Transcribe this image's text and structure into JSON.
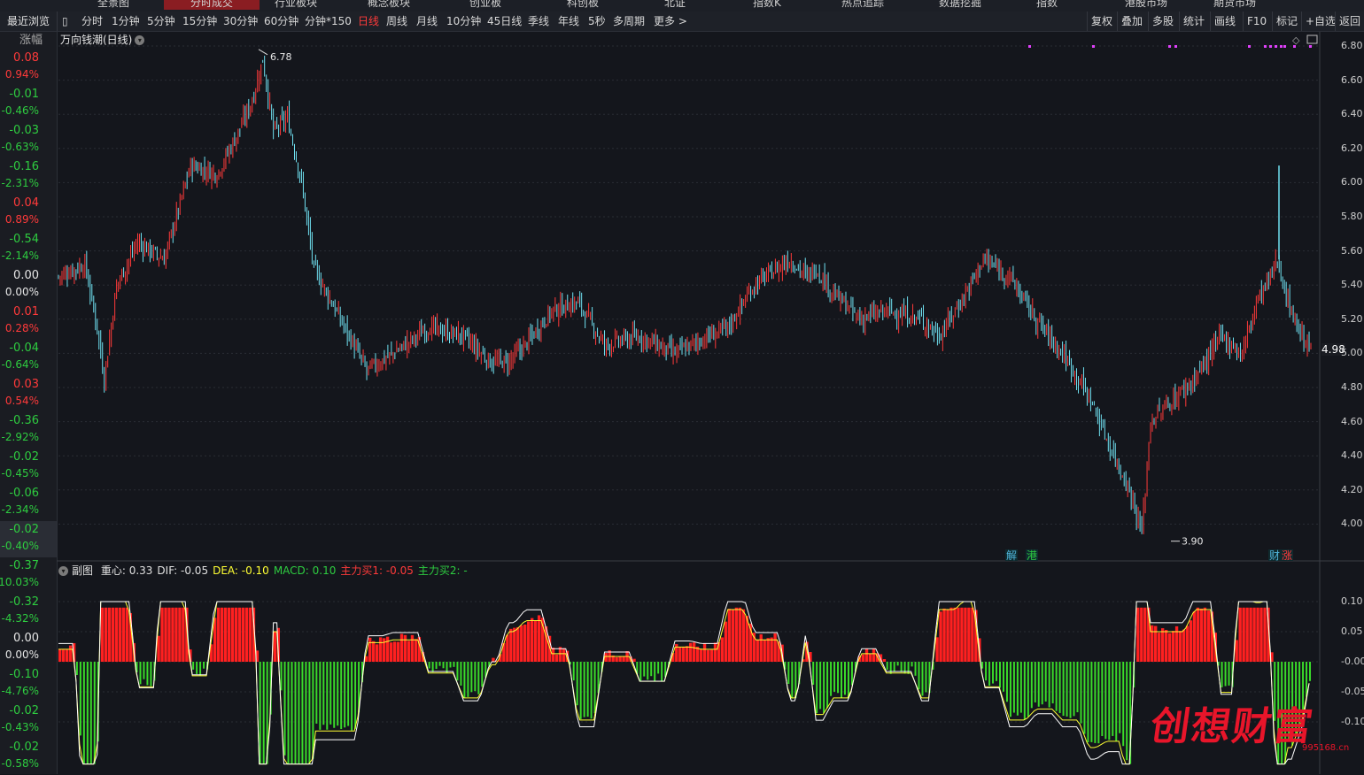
{
  "topnav": [
    "全景图",
    "分时成交",
    "行业板块",
    "概念板块",
    "创业板",
    "科创板",
    "北证",
    "指数K",
    "热点追踪",
    "数据挖掘",
    "指数",
    "港股市场",
    "期货市场"
  ],
  "toolbar": {
    "recent": "最近浏览",
    "periods": [
      "分时",
      "1分钟",
      "5分钟",
      "15分钟",
      "30分钟",
      "60分钟",
      "分钟*150",
      "日线",
      "周线",
      "月线",
      "10分钟",
      "45日线",
      "季线",
      "年线",
      "5秒",
      "多周期",
      "更多 >"
    ],
    "active_period": "日线",
    "right_tools": [
      "复权",
      "叠加",
      "多股",
      "统计",
      "画线",
      "F10",
      "标记",
      "+自选",
      "返回"
    ]
  },
  "left_panel": {
    "header": "涨幅",
    "items": [
      {
        "price": "0.08",
        "pct": "0.94%",
        "dir": "up"
      },
      {
        "price": "-0.01",
        "pct": "-0.46%",
        "dir": "dn"
      },
      {
        "price": "-0.03",
        "pct": "-0.63%",
        "dir": "dn"
      },
      {
        "price": "-0.16",
        "pct": "-2.31%",
        "dir": "dn"
      },
      {
        "price": "0.04",
        "pct": "0.89%",
        "dir": "up"
      },
      {
        "price": "-0.54",
        "pct": "-2.14%",
        "dir": "dn"
      },
      {
        "price": "0.00",
        "pct": "0.00%",
        "dir": "flat"
      },
      {
        "price": "0.01",
        "pct": "0.28%",
        "dir": "up"
      },
      {
        "price": "-0.04",
        "pct": "-0.64%",
        "dir": "dn"
      },
      {
        "price": "0.03",
        "pct": "0.54%",
        "dir": "up"
      },
      {
        "price": "-0.36",
        "pct": "-2.92%",
        "dir": "dn"
      },
      {
        "price": "-0.02",
        "pct": "-0.45%",
        "dir": "dn"
      },
      {
        "price": "-0.06",
        "pct": "-2.34%",
        "dir": "dn"
      },
      {
        "price": "-0.02",
        "pct": "-0.40%",
        "dir": "dn",
        "highlight": true
      },
      {
        "price": "-0.37",
        "pct": "-10.03%",
        "dir": "dn"
      },
      {
        "price": "-0.32",
        "pct": "-4.32%",
        "dir": "dn"
      },
      {
        "price": "0.00",
        "pct": "0.00%",
        "dir": "flat"
      },
      {
        "price": "-0.10",
        "pct": "-4.76%",
        "dir": "dn"
      },
      {
        "price": "-0.02",
        "pct": "-0.43%",
        "dir": "dn"
      },
      {
        "price": "-0.02",
        "pct": "-0.58%",
        "dir": "dn"
      }
    ]
  },
  "chart": {
    "title": "万向钱潮(日线)",
    "high_label": "6.78",
    "low_label": "3.90",
    "last_price": "4.98",
    "price_axis": [
      "6.80",
      "6.60",
      "6.40",
      "6.20",
      "6.00",
      "5.80",
      "5.60",
      "5.40",
      "5.20",
      "5.00",
      "4.80",
      "4.60",
      "4.40",
      "4.20",
      "4.00"
    ],
    "markers": [
      {
        "text": "解",
        "color": "#4fb3d9"
      },
      {
        "text": "港",
        "color": "#2ecc40"
      },
      {
        "text": "财",
        "color": "#4fb3d9"
      },
      {
        "text": "涨",
        "color": "#ff3a3a"
      }
    ],
    "colors": {
      "up": "#ff3a3a",
      "down": "#6fe0f0",
      "bg": "#14161c",
      "grid": "#2a2d34"
    }
  },
  "indicator": {
    "name": "副图",
    "items": [
      {
        "label": "重心: 0.33",
        "color": "#e0e0e0"
      },
      {
        "label": "DIF: -0.05",
        "color": "#e0e0e0"
      },
      {
        "label": "DEA: -0.10",
        "color": "#ffff33"
      },
      {
        "label": "MACD: 0.10",
        "color": "#2ecc40"
      },
      {
        "label": "主力买1: -0.05",
        "color": "#ff3a3a"
      },
      {
        "label": "主力买2: -",
        "color": "#2ecc40"
      }
    ],
    "axis": [
      "0.10",
      "0.05",
      "-0.00",
      "-0.05",
      "-0.10"
    ]
  },
  "watermark": {
    "text": "创想财富",
    "url": "995168.cn"
  }
}
